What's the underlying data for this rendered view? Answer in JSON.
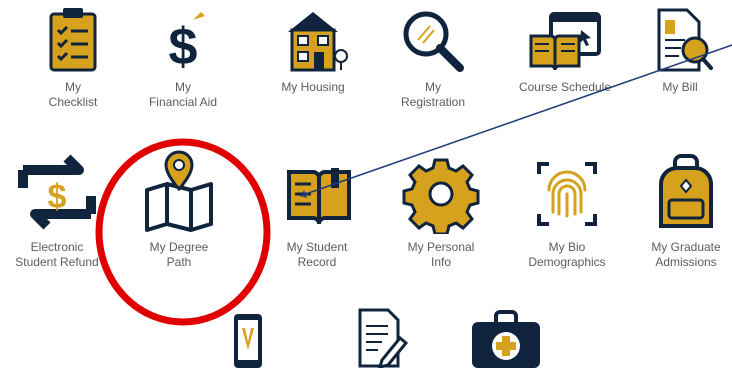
{
  "colors": {
    "navy": "#10243e",
    "gold": "#d6a21d",
    "label": "#5c5c5c",
    "highlight": "#e00000",
    "pointer_line": "#1f3b78"
  },
  "tiles": [
    {
      "label": "My\nChecklist",
      "icon": "clipboard-checklist-icon"
    },
    {
      "label": "My\nFinancial Aid",
      "icon": "dollar-sign-icon"
    },
    {
      "label": "My Housing",
      "icon": "house-icon"
    },
    {
      "label": "My\nRegistration",
      "icon": "magnifying-glass-icon"
    },
    {
      "label": "Course Schedule",
      "icon": "book-screen-icon"
    },
    {
      "label": "My Bill",
      "icon": "bill-search-icon"
    },
    {
      "label": "Electronic\nStudent Refund",
      "icon": "refund-arrows-icon"
    },
    {
      "label": "My Degree\nPath",
      "icon": "map-pin-icon"
    },
    {
      "label": "My Student\nRecord",
      "icon": "open-book-icon"
    },
    {
      "label": "My Personal\nInfo",
      "icon": "gear-icon"
    },
    {
      "label": "My Bio\nDemographics",
      "icon": "fingerprint-icon"
    },
    {
      "label": "My Graduate\nAdmissions",
      "icon": "backpack-icon"
    },
    {
      "label": "",
      "icon": "phone-icon"
    },
    {
      "label": "",
      "icon": "document-pencil-icon"
    },
    {
      "label": "",
      "icon": "medical-kit-icon"
    }
  ]
}
